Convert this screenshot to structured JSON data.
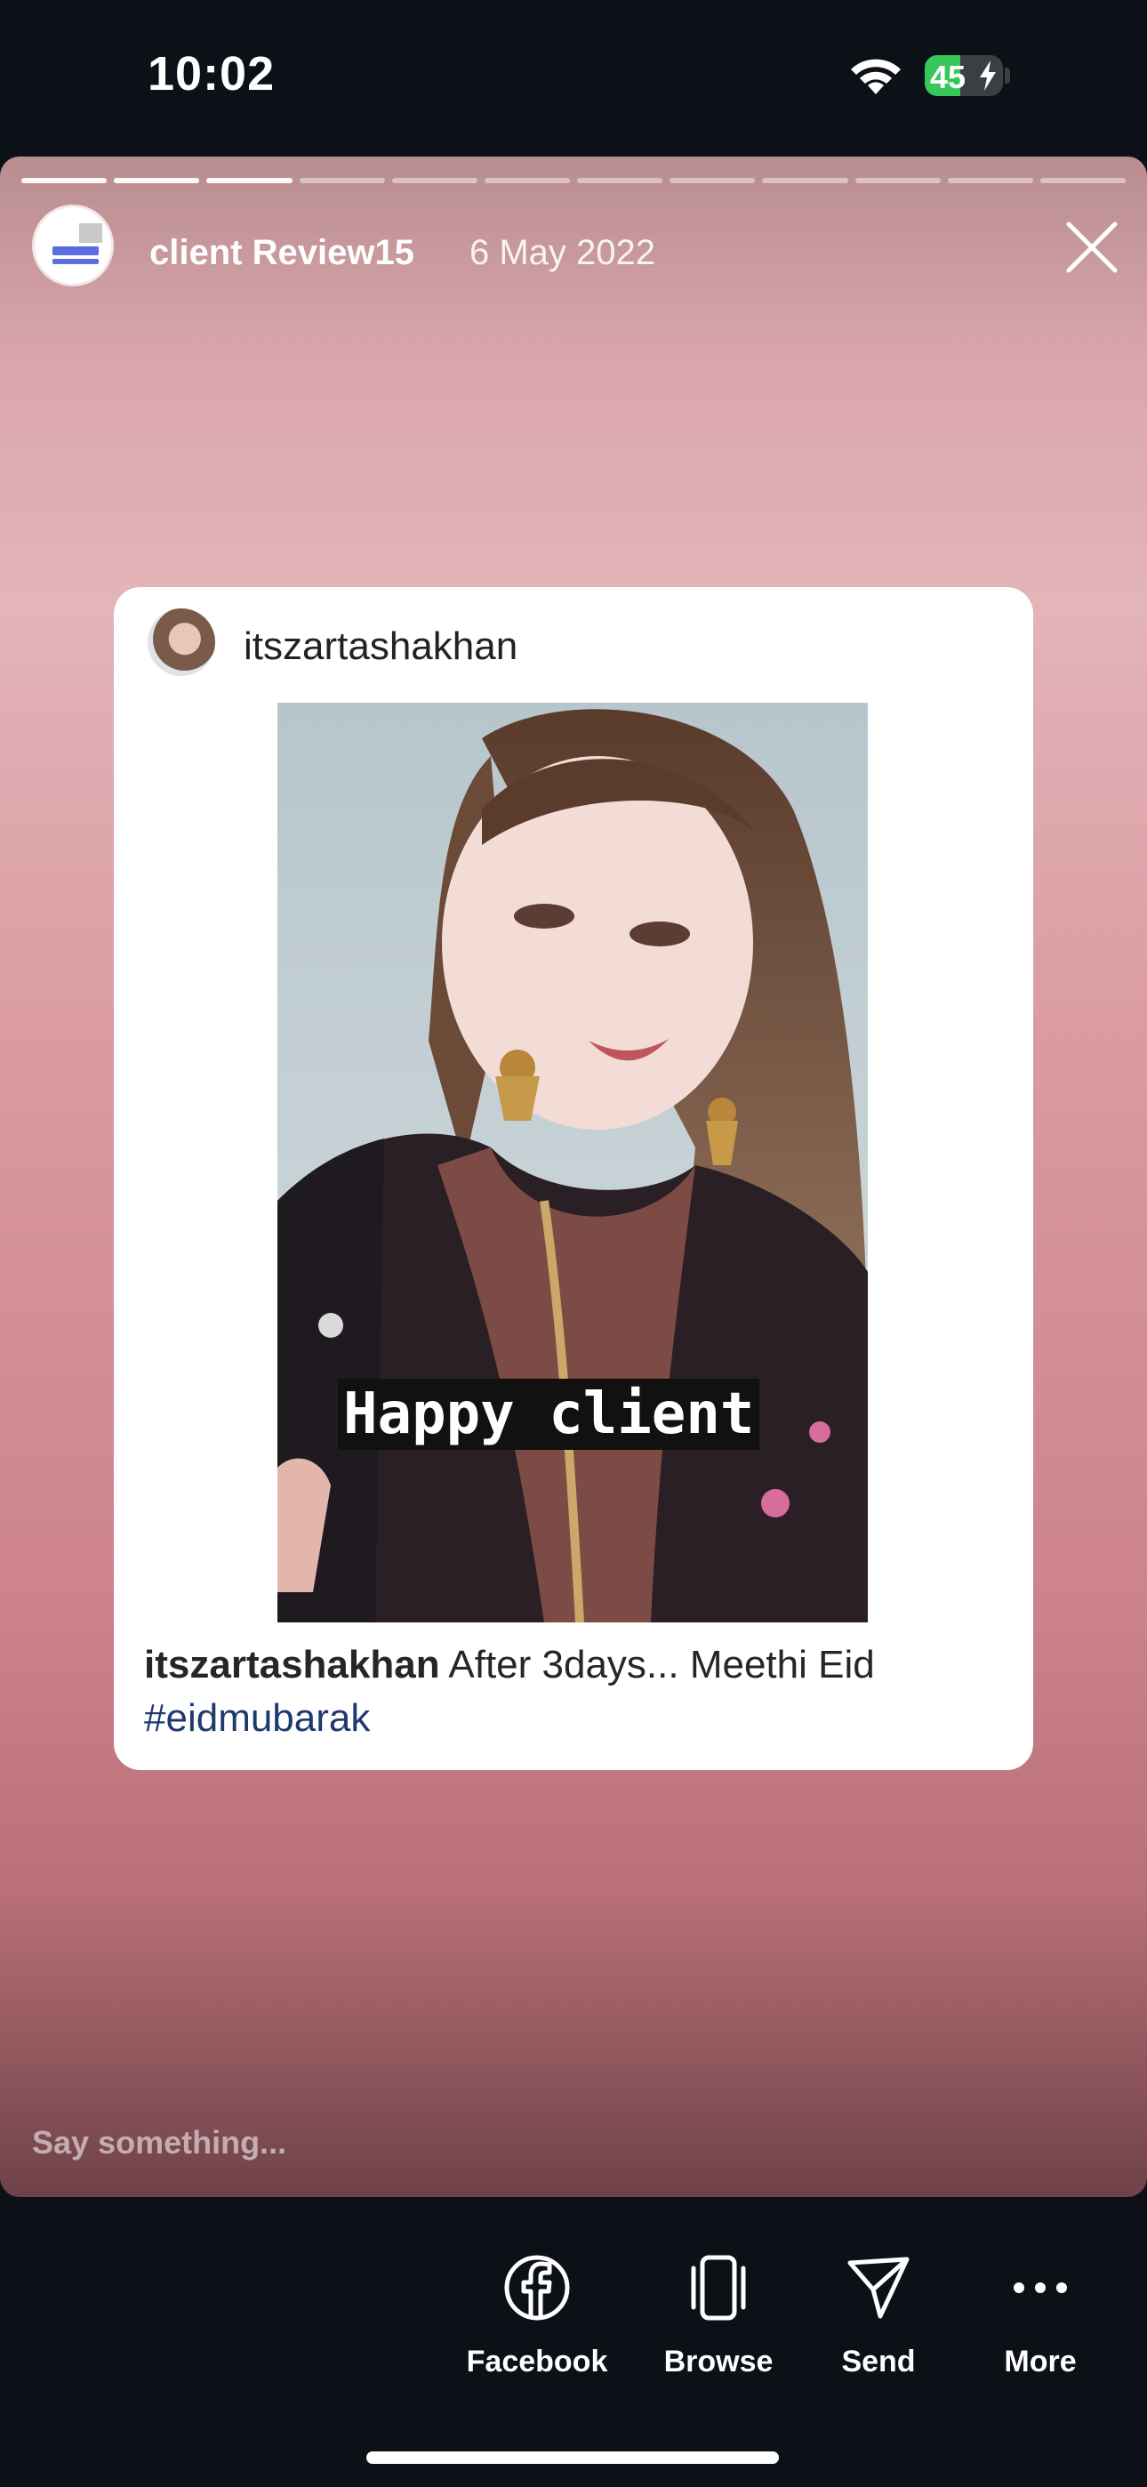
{
  "status_bar": {
    "time": "10:02",
    "battery_level": "45",
    "battery_fraction": 0.45,
    "charging": true
  },
  "story": {
    "segments_total": 12,
    "segments_viewed": 3,
    "username": "client Review15",
    "date": "6 May 2022",
    "close_icon": "close-icon",
    "reply_placeholder": "Say something..."
  },
  "post": {
    "username": "itszartashakhan",
    "overlay_text": "Happy client",
    "caption_user": "itszartashakhan",
    "caption_text": " After 3days... Meethi Eid",
    "hashtag": "#eidmubarak"
  },
  "share_bar": {
    "items": [
      {
        "label": "Facebook",
        "icon": "facebook-icon"
      },
      {
        "label": "Browse",
        "icon": "browse-icon"
      },
      {
        "label": "Send",
        "icon": "send-icon"
      },
      {
        "label": "More",
        "icon": "more-icon"
      }
    ]
  },
  "colors": {
    "background": "#0c1117",
    "battery_green": "#35c759",
    "hashtag": "#1e3a6e"
  }
}
